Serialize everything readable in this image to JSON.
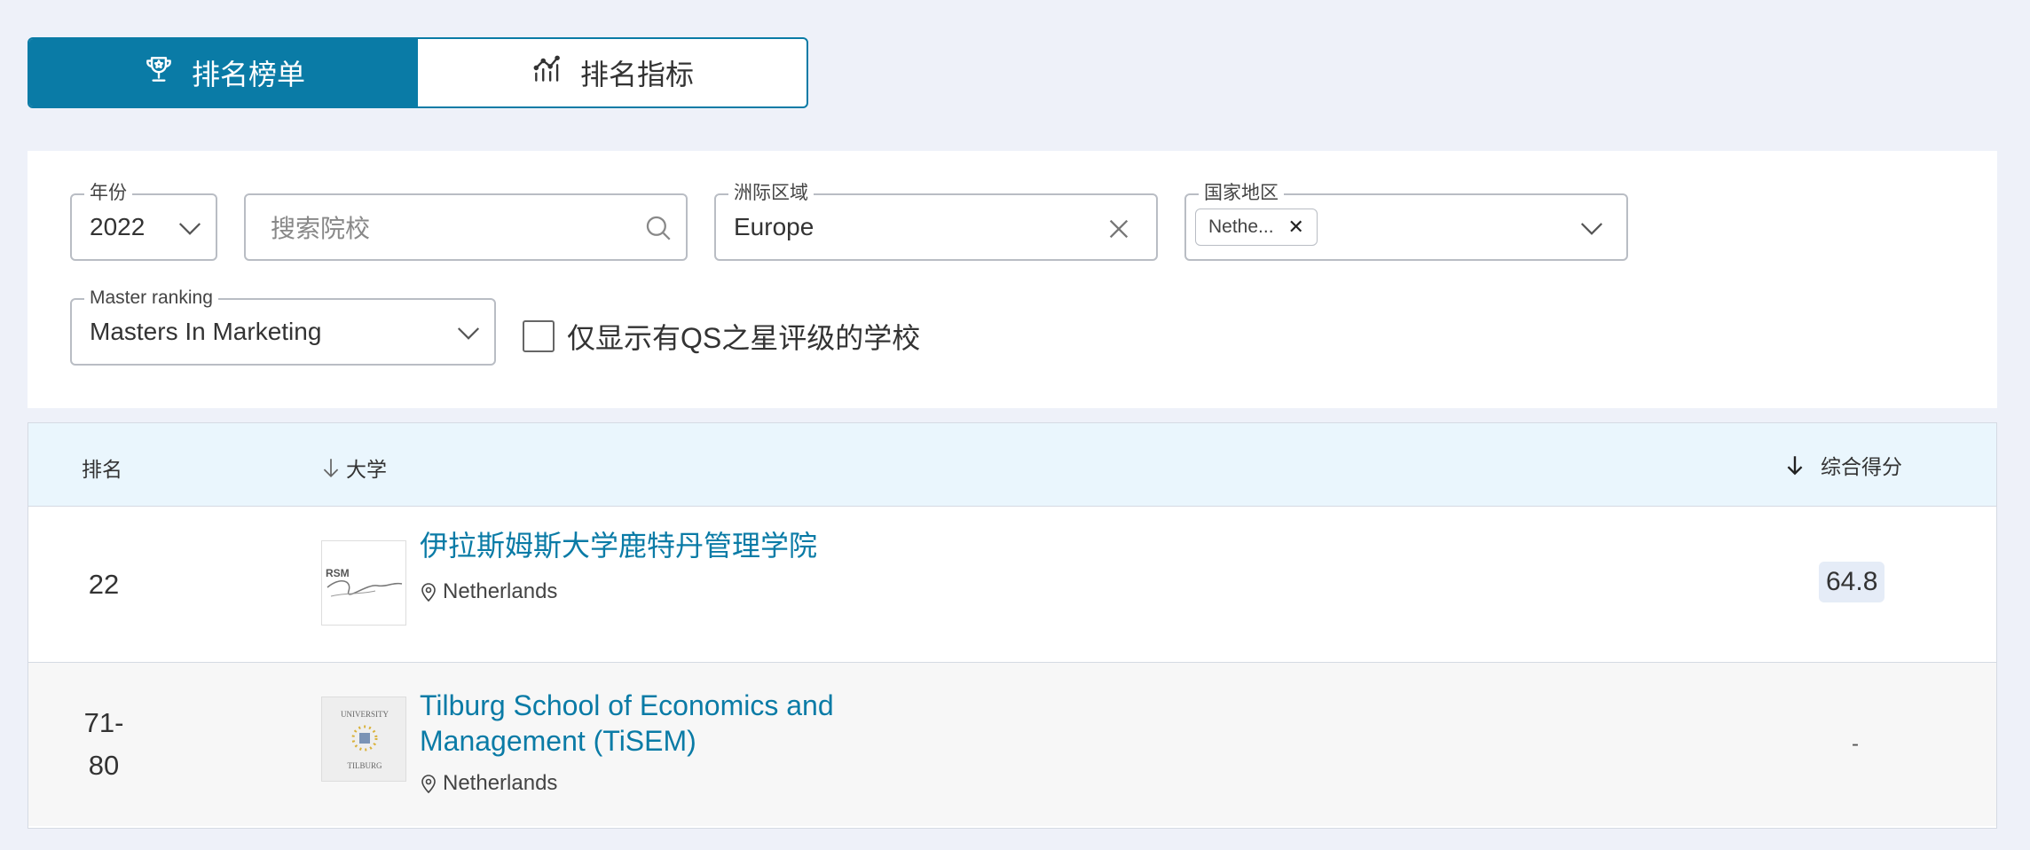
{
  "tabs": [
    {
      "label": "排名榜单",
      "active": true,
      "icon": "trophy-icon"
    },
    {
      "label": "排名指标",
      "active": false,
      "icon": "bar-chart-icon"
    }
  ],
  "filters": {
    "year": {
      "legend": "年份",
      "value": "2022"
    },
    "search": {
      "placeholder": "搜索院校"
    },
    "region": {
      "legend": "洲际区域",
      "value": "Europe"
    },
    "country": {
      "legend": "国家地区",
      "chip": "Nethe..."
    },
    "master_ranking": {
      "legend": "Master ranking",
      "value": "Masters In Marketing"
    },
    "qs_stars_only": {
      "label": "仅显示有QS之星评级的学校",
      "checked": false
    }
  },
  "table": {
    "headers": {
      "rank": "排名",
      "university": "大学",
      "score": "综合得分"
    },
    "rows": [
      {
        "rank": "22",
        "name": "伊拉斯姆斯大学鹿特丹管理学院",
        "location": "Netherlands",
        "score": "64.8",
        "logo_text": "RSM"
      },
      {
        "rank_line1": "71-",
        "rank_line2": "80",
        "name_line1": "Tilburg School of Economics and",
        "name_line2": "Management (TiSEM)",
        "location": "Netherlands",
        "score": "-",
        "logo_text_top": "UNIVERSITY",
        "logo_text_bottom": "TILBURG"
      }
    ]
  },
  "colors": {
    "accent": "#0a7ba6",
    "page_bg": "#eef1f9",
    "header_bg": "#eaf6fd"
  }
}
